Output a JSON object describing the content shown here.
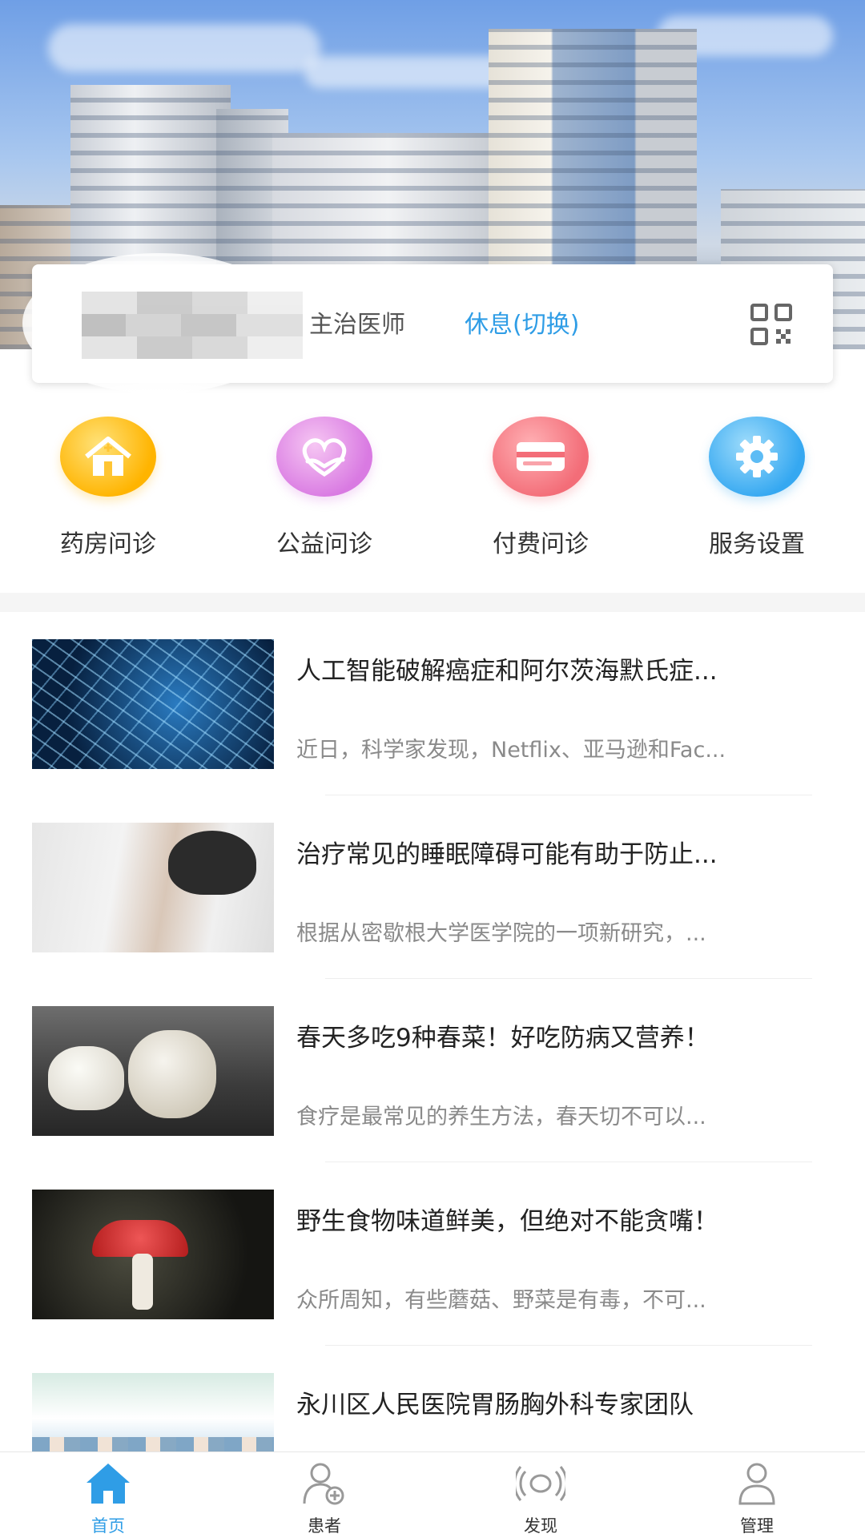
{
  "doctor_card": {
    "title": "主治医师",
    "status_toggle": "休息(切换)"
  },
  "functions": [
    {
      "label": "药房问诊",
      "icon": "pharmacy-home-icon"
    },
    {
      "label": "公益问诊",
      "icon": "charity-heart-icon"
    },
    {
      "label": "付费问诊",
      "icon": "payment-card-icon"
    },
    {
      "label": "服务设置",
      "icon": "settings-gear-icon"
    }
  ],
  "articles": [
    {
      "title": "人工智能破解癌症和阿尔茨海默氏症...",
      "summary": "近日，科学家发现，Netflix、亚马逊和Fac..."
    },
    {
      "title": "治疗常见的睡眠障碍可能有助于防止...",
      "summary": "根据从密歇根大学医学院的一项新研究，..."
    },
    {
      "title": "春天多吃9种春菜！好吃防病又营养！",
      "summary": "食疗是最常见的养生方法，春天切不可以..."
    },
    {
      "title": "野生食物味道鲜美，但绝对不能贪嘴！",
      "summary": "众所周知，有些蘑菇、野菜是有毒，不可..."
    },
    {
      "title": "永川区人民医院胃肠胸外科专家团队",
      "summary": ""
    }
  ],
  "tabbar": {
    "items": [
      {
        "label": "首页",
        "icon": "home-icon",
        "active": true
      },
      {
        "label": "患者",
        "icon": "patient-add-icon",
        "active": false
      },
      {
        "label": "发现",
        "icon": "discover-broadcast-icon",
        "active": false
      },
      {
        "label": "管理",
        "icon": "user-manage-icon",
        "active": false
      }
    ]
  },
  "colors": {
    "accent": "#2f9de6",
    "yellow": "#ffb400",
    "pink": "#d97ae2",
    "red": "#f36d78",
    "blue": "#35a8f1"
  }
}
